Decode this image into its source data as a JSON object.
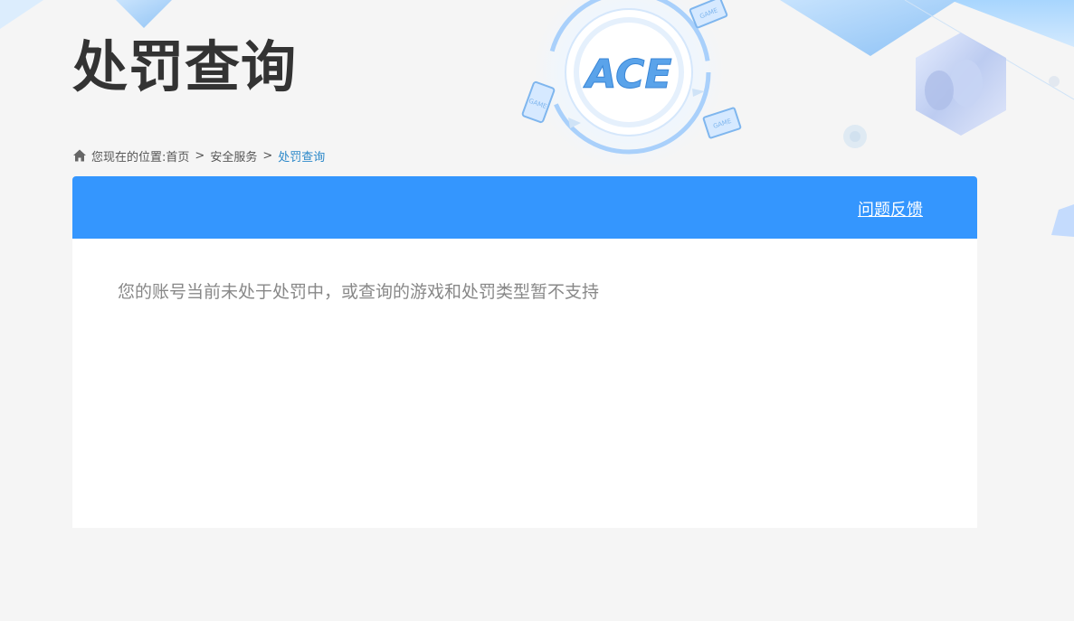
{
  "page": {
    "title": "处罚查询"
  },
  "breadcrumb": {
    "prefix": "您现在的位置:",
    "items": [
      "首页",
      "安全服务",
      "处罚查询"
    ],
    "separator": ">"
  },
  "panel": {
    "feedback_label": "问题反馈",
    "message": "您的账号当前未处于处罚中，或查询的游戏和处罚类型暂不支持"
  },
  "logo": {
    "text": "ACE",
    "device_label": "GAME"
  },
  "colors": {
    "header_blue": "#3496fe",
    "title": "#333333",
    "current_crumb": "#2b88c9",
    "message": "#888888",
    "background": "#f5f5f5"
  }
}
